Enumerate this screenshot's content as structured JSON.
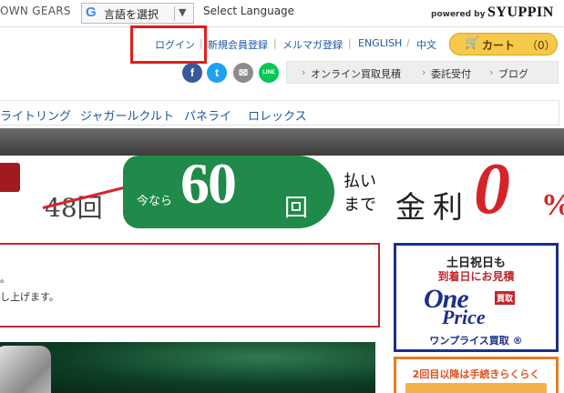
{
  "topbar": {
    "brand_partial": "OWN GEARS",
    "translate_google": "G",
    "translate_label": "言語を選択",
    "translate_arrow": "▼",
    "select_language": "Select Language",
    "powered_by": "powered by",
    "logo": "SYUPPIN"
  },
  "header": {
    "links": {
      "login": "ログイン",
      "register": "新規会員登録",
      "newsletter": "メルマガ登録",
      "english": "ENGLISH",
      "chinese": "中文"
    },
    "separator": "|",
    "cart": {
      "label": "カート",
      "count": "（0）",
      "icon": "cart-icon"
    },
    "social": [
      "f",
      "t",
      "✉",
      "LINE"
    ],
    "subnav": [
      "オンライン買取見積",
      "委託受付",
      "ブログ"
    ],
    "subnav_arrow": "›"
  },
  "category_menu": [
    "ライトリング",
    "ジャガールクルト",
    "パネライ",
    "ロレックス"
  ],
  "banner": {
    "old_count": "48回",
    "now": "今なら",
    "count": "60",
    "kai": "回",
    "harai": "払い\nまで",
    "kinri": "金利",
    "zero": "0",
    "pct": "%"
  },
  "notice": {
    "line1": "。",
    "line2": "し上げます。"
  },
  "side_ad": {
    "line1": "土日祝日も",
    "line2": "到着日にお見積",
    "one": "One",
    "kaitori": "買取",
    "price": "Price",
    "line3": "ワンプライス買取 ®"
  },
  "side_ad2": {
    "text": "2回目以降は手続きらくらく"
  },
  "colors": {
    "link": "#1b5aa6",
    "accent_red": "#c0272d",
    "green": "#1f8a4a",
    "cart_yellow": "#f6c94a",
    "ad_blue": "#1b2f8a"
  }
}
